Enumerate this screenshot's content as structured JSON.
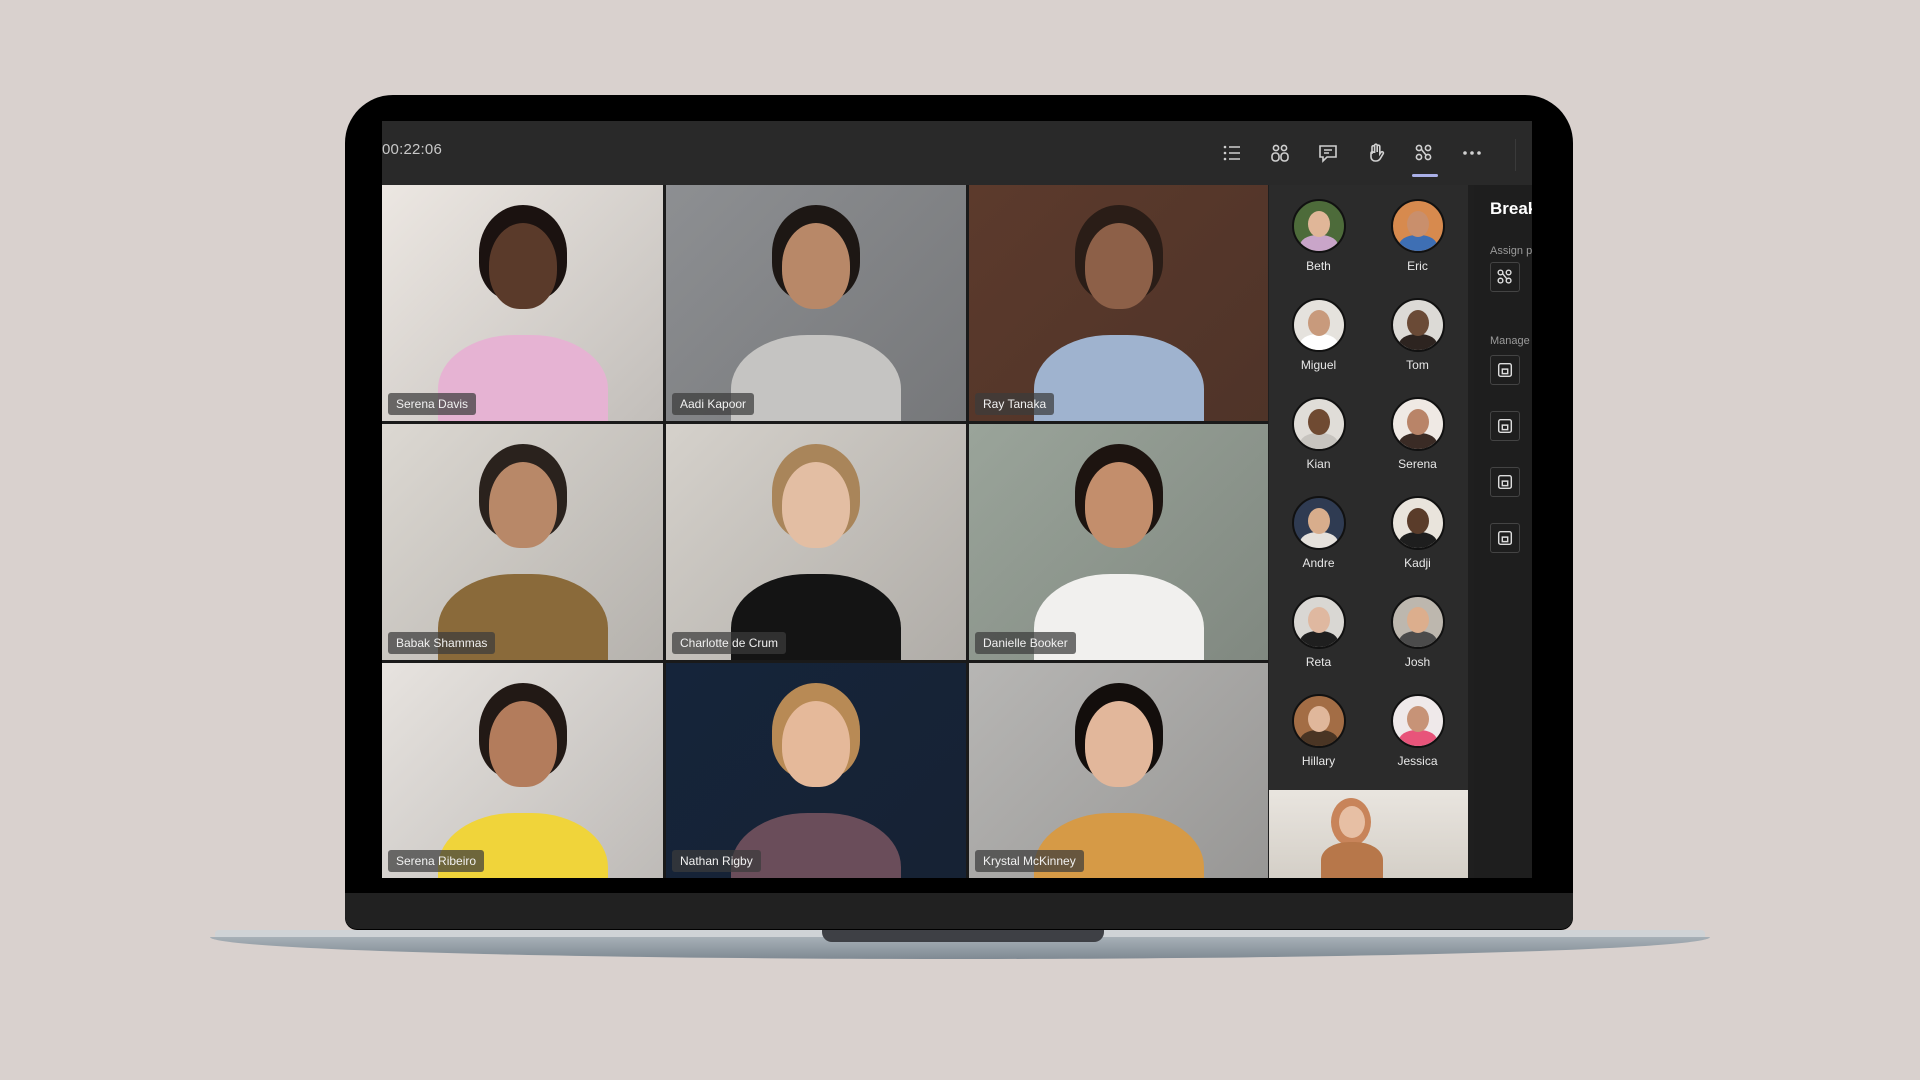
{
  "meeting": {
    "timer": "00:22:06",
    "toolbar": [
      {
        "name": "agenda-list-icon",
        "label": "Show participants list"
      },
      {
        "name": "participants-icon",
        "label": "People"
      },
      {
        "name": "chat-icon",
        "label": "Chat"
      },
      {
        "name": "raise-hand-icon",
        "label": "Raise hand"
      },
      {
        "name": "breakout-rooms-icon",
        "label": "Breakout rooms",
        "active": true
      },
      {
        "name": "more-options-icon",
        "label": "More actions"
      }
    ]
  },
  "video_tiles": [
    {
      "name": "Serena Davis",
      "label": "Serena Davis",
      "bg": "#ece7e2",
      "skin": "#5a3a2a",
      "shirt": "#e6b3d3",
      "hair": "#1b1210"
    },
    {
      "name": "Aadi Kapoor",
      "label": "Aadi Kapoor",
      "bg": "#8d8f92",
      "skin": "#b88868",
      "shirt": "#c5c4c2",
      "hair": "#1d1714"
    },
    {
      "name": "Ray Tanaka",
      "label": "Ray Tanaka",
      "bg": "#5c3a2c",
      "skin": "#8d6048",
      "shirt": "#9fb3cf",
      "hair": "#2a1d17"
    },
    {
      "name": "Babak Shammas",
      "label": "Babak Shammas",
      "bg": "#dcd8d2",
      "skin": "#b88868",
      "shirt": "#8a6a3a",
      "hair": "#2a221d"
    },
    {
      "name": "Charlotte de Crum",
      "label": "Charlotte de Crum",
      "bg": "#d5d1cb",
      "skin": "#e3bea3",
      "shirt": "#141414",
      "hair": "#a9855a"
    },
    {
      "name": "Danielle Booker",
      "label": "Danielle Booker",
      "bg": "#9aa49a",
      "skin": "#c38e6c",
      "shirt": "#f1f0ee",
      "hair": "#1d1410"
    },
    {
      "name": "Serena Ribeiro",
      "label": "Serena Ribeiro",
      "bg": "#e7e3df",
      "skin": "#b37c5c",
      "shirt": "#f0d43a",
      "hair": "#221915"
    },
    {
      "name": "Nathan Rigby",
      "label": "Nathan Rigby",
      "bg": "#15243a",
      "skin": "#e5b99a",
      "shirt": "#6a4d5a",
      "hair": "#b88a55"
    },
    {
      "name": "Krystal McKinney",
      "label": "Krystal McKinney",
      "bg": "#b7b6b4",
      "skin": "#e2b79b",
      "shirt": "#d69a46",
      "hair": "#130e0c"
    }
  ],
  "participants": [
    {
      "name": "Beth",
      "bg": "#4d6b3a",
      "skin": "#e0b698",
      "shirt": "#c9a5c9"
    },
    {
      "name": "Eric",
      "bg": "#d78a4e",
      "skin": "#c98f6c",
      "shirt": "#3e6fb4"
    },
    {
      "name": "Miguel",
      "bg": "#e5e2dd",
      "skin": "#c89a7c",
      "shirt": "#ffffff"
    },
    {
      "name": "Tom",
      "bg": "#dcdad6",
      "skin": "#6a4a36",
      "shirt": "#2d2420"
    },
    {
      "name": "Kian",
      "bg": "#e0ddd8",
      "skin": "#6f4a32",
      "shirt": "#c7c4bf"
    },
    {
      "name": "Serena",
      "bg": "#efe9e4",
      "skin": "#b98468",
      "shirt": "#3a2b25"
    },
    {
      "name": "Andre",
      "bg": "#2f3b52",
      "skin": "#d8ad8c",
      "shirt": "#e5e1dc"
    },
    {
      "name": "Kadji",
      "bg": "#e9e4dc",
      "skin": "#5a3c2a",
      "shirt": "#1e1e1e"
    },
    {
      "name": "Reta",
      "bg": "#d9d7d3",
      "skin": "#dfb8a0",
      "shirt": "#1f1f1f"
    },
    {
      "name": "Josh",
      "bg": "#bdb7ae",
      "skin": "#dcae8d",
      "shirt": "#4b4b4b"
    },
    {
      "name": "Hillary",
      "bg": "#a36d45",
      "skin": "#e0b79b",
      "shirt": "#4a3524"
    },
    {
      "name": "Jessica",
      "bg": "#efe9ea",
      "skin": "#c79377",
      "shirt": "#e8547a"
    }
  ],
  "breakout_panel": {
    "title": "Breakout rooms",
    "assign_label": "Assign participants",
    "manage_label": "Manage rooms",
    "room_count": 4
  },
  "colors": {
    "accent": "#aab0e8",
    "toolbar_bg": "#292929",
    "roster_bg": "#2b2b2b",
    "page_bg": "#d9d1ce"
  }
}
